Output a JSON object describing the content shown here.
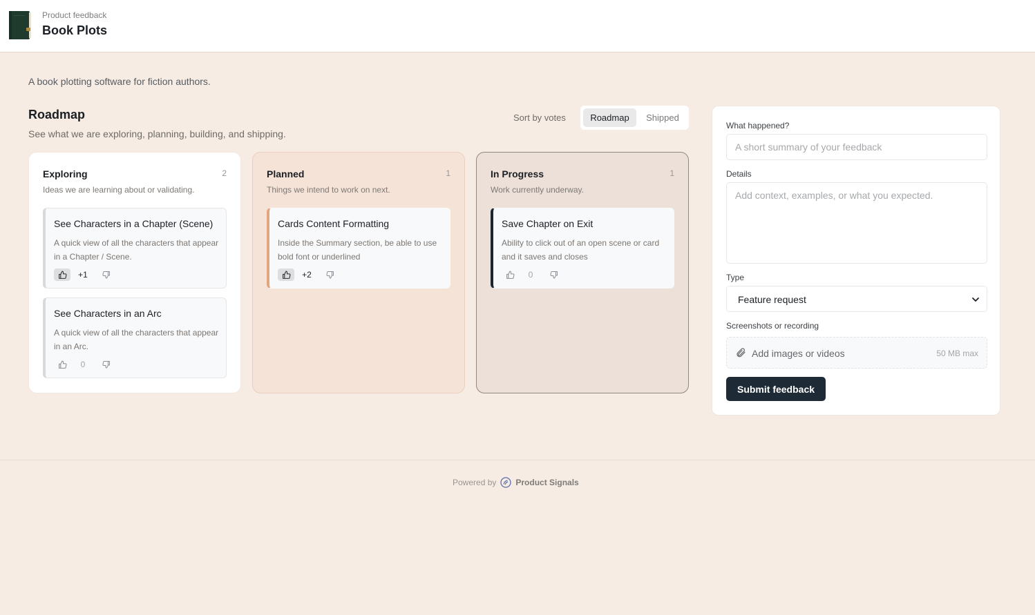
{
  "header": {
    "subtitle": "Product feedback",
    "title": "Book Plots",
    "logo_icon": "book-icon"
  },
  "tagline": "A book plotting software for fiction authors.",
  "roadmap": {
    "title": "Roadmap",
    "subtitle": "See what we are exploring, planning, building, and shipping.",
    "sort_label": "Sort by votes",
    "tabs": [
      {
        "label": "Roadmap",
        "active": true
      },
      {
        "label": "Shipped",
        "active": false
      }
    ],
    "columns": [
      {
        "title": "Exploring",
        "count": "2",
        "description": "Ideas we are learning about or validating.",
        "cards": [
          {
            "title": "See Characters in a Chapter (Scene)",
            "body": "A quick view of all the characters that appear in a Chapter / Scene.",
            "votes": "+1",
            "upvoted": true
          },
          {
            "title": "See Characters in an Arc",
            "body": "A quick view of all the characters that appear in an Arc.",
            "votes": "0",
            "upvoted": false
          }
        ]
      },
      {
        "title": "Planned",
        "count": "1",
        "description": "Things we intend to work on next.",
        "cards": [
          {
            "title": "Cards Content Formatting",
            "body": "Inside the Summary section, be able to use bold font or underlined",
            "votes": "+2",
            "upvoted": true
          }
        ]
      },
      {
        "title": "In Progress",
        "count": "1",
        "description": "Work currently underway.",
        "cards": [
          {
            "title": "Save Chapter on Exit",
            "body": "Ability to click out of an open scene or card and it saves and closes",
            "votes": "0",
            "upvoted": false
          }
        ]
      }
    ]
  },
  "form": {
    "summary_label": "What happened?",
    "summary_placeholder": "A short summary of your feedback",
    "details_label": "Details",
    "details_placeholder": "Add context, examples, or what you expected.",
    "type_label": "Type",
    "type_value": "Feature request",
    "media_label": "Screenshots or recording",
    "media_text": "Add images or videos",
    "media_max": "50 MB max",
    "submit_label": "Submit feedback"
  },
  "footer": {
    "powered_by": "Powered by",
    "brand": "Product Signals"
  },
  "colors": {
    "background": "#f6ece4",
    "planned_accent": "#e2a57f",
    "progress_accent": "#1d2630",
    "submit_bg": "#1e2a36"
  }
}
